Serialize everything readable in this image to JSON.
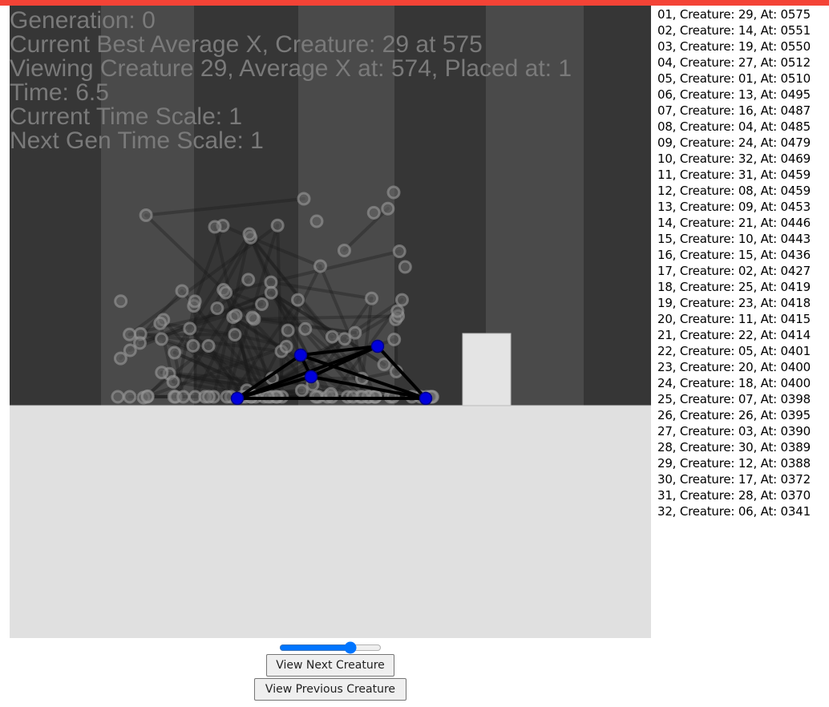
{
  "colors": {
    "top_bar": "#f44336",
    "ground": "#e0e0e0",
    "hud_text": "#7a7a7a",
    "highlight_node": "#0000dd",
    "highlight_muscle": "#000000",
    "stripe_dark": "#363636",
    "stripe_light": "#4a4a4a"
  },
  "hud": {
    "generation": "Generation: 0",
    "best": "Current Best Average X, Creature: 29 at 575",
    "viewing": "Viewing Creature 29, Average X at: 574, Placed at: 1",
    "time": "Time: 6.5",
    "time_scale": "Current Time Scale: 1",
    "next_time_scale": "Next Gen Time Scale: 1"
  },
  "leaderboard": [
    "01, Creature: 29, At: 0575",
    "02, Creature: 14, At: 0551",
    "03, Creature: 19, At: 0550",
    "04, Creature: 27, At: 0512",
    "05, Creature: 01, At: 0510",
    "06, Creature: 13, At: 0495",
    "07, Creature: 16, At: 0487",
    "08, Creature: 04, At: 0485",
    "09, Creature: 24, At: 0479",
    "10, Creature: 32, At: 0469",
    "11, Creature: 31, At: 0459",
    "12, Creature: 08, At: 0459",
    "13, Creature: 09, At: 0453",
    "14, Creature: 21, At: 0446",
    "15, Creature: 10, At: 0443",
    "16, Creature: 15, At: 0436",
    "17, Creature: 02, At: 0427",
    "18, Creature: 25, At: 0419",
    "19, Creature: 23, At: 0418",
    "20, Creature: 11, At: 0415",
    "21, Creature: 22, At: 0414",
    "22, Creature: 05, At: 0401",
    "23, Creature: 20, At: 0400",
    "24, Creature: 18, At: 0400",
    "25, Creature: 07, At: 0398",
    "26, Creature: 26, At: 0395",
    "27, Creature: 03, At: 0390",
    "28, Creature: 30, At: 0389",
    "29, Creature: 12, At: 0388",
    "30, Creature: 17, At: 0372",
    "31, Creature: 28, At: 0370",
    "32, Creature: 06, At: 0341"
  ],
  "controls": {
    "time_scale_slider": 0.72,
    "next_button": "View Next Creature",
    "prev_button": "View Previous Creature"
  }
}
